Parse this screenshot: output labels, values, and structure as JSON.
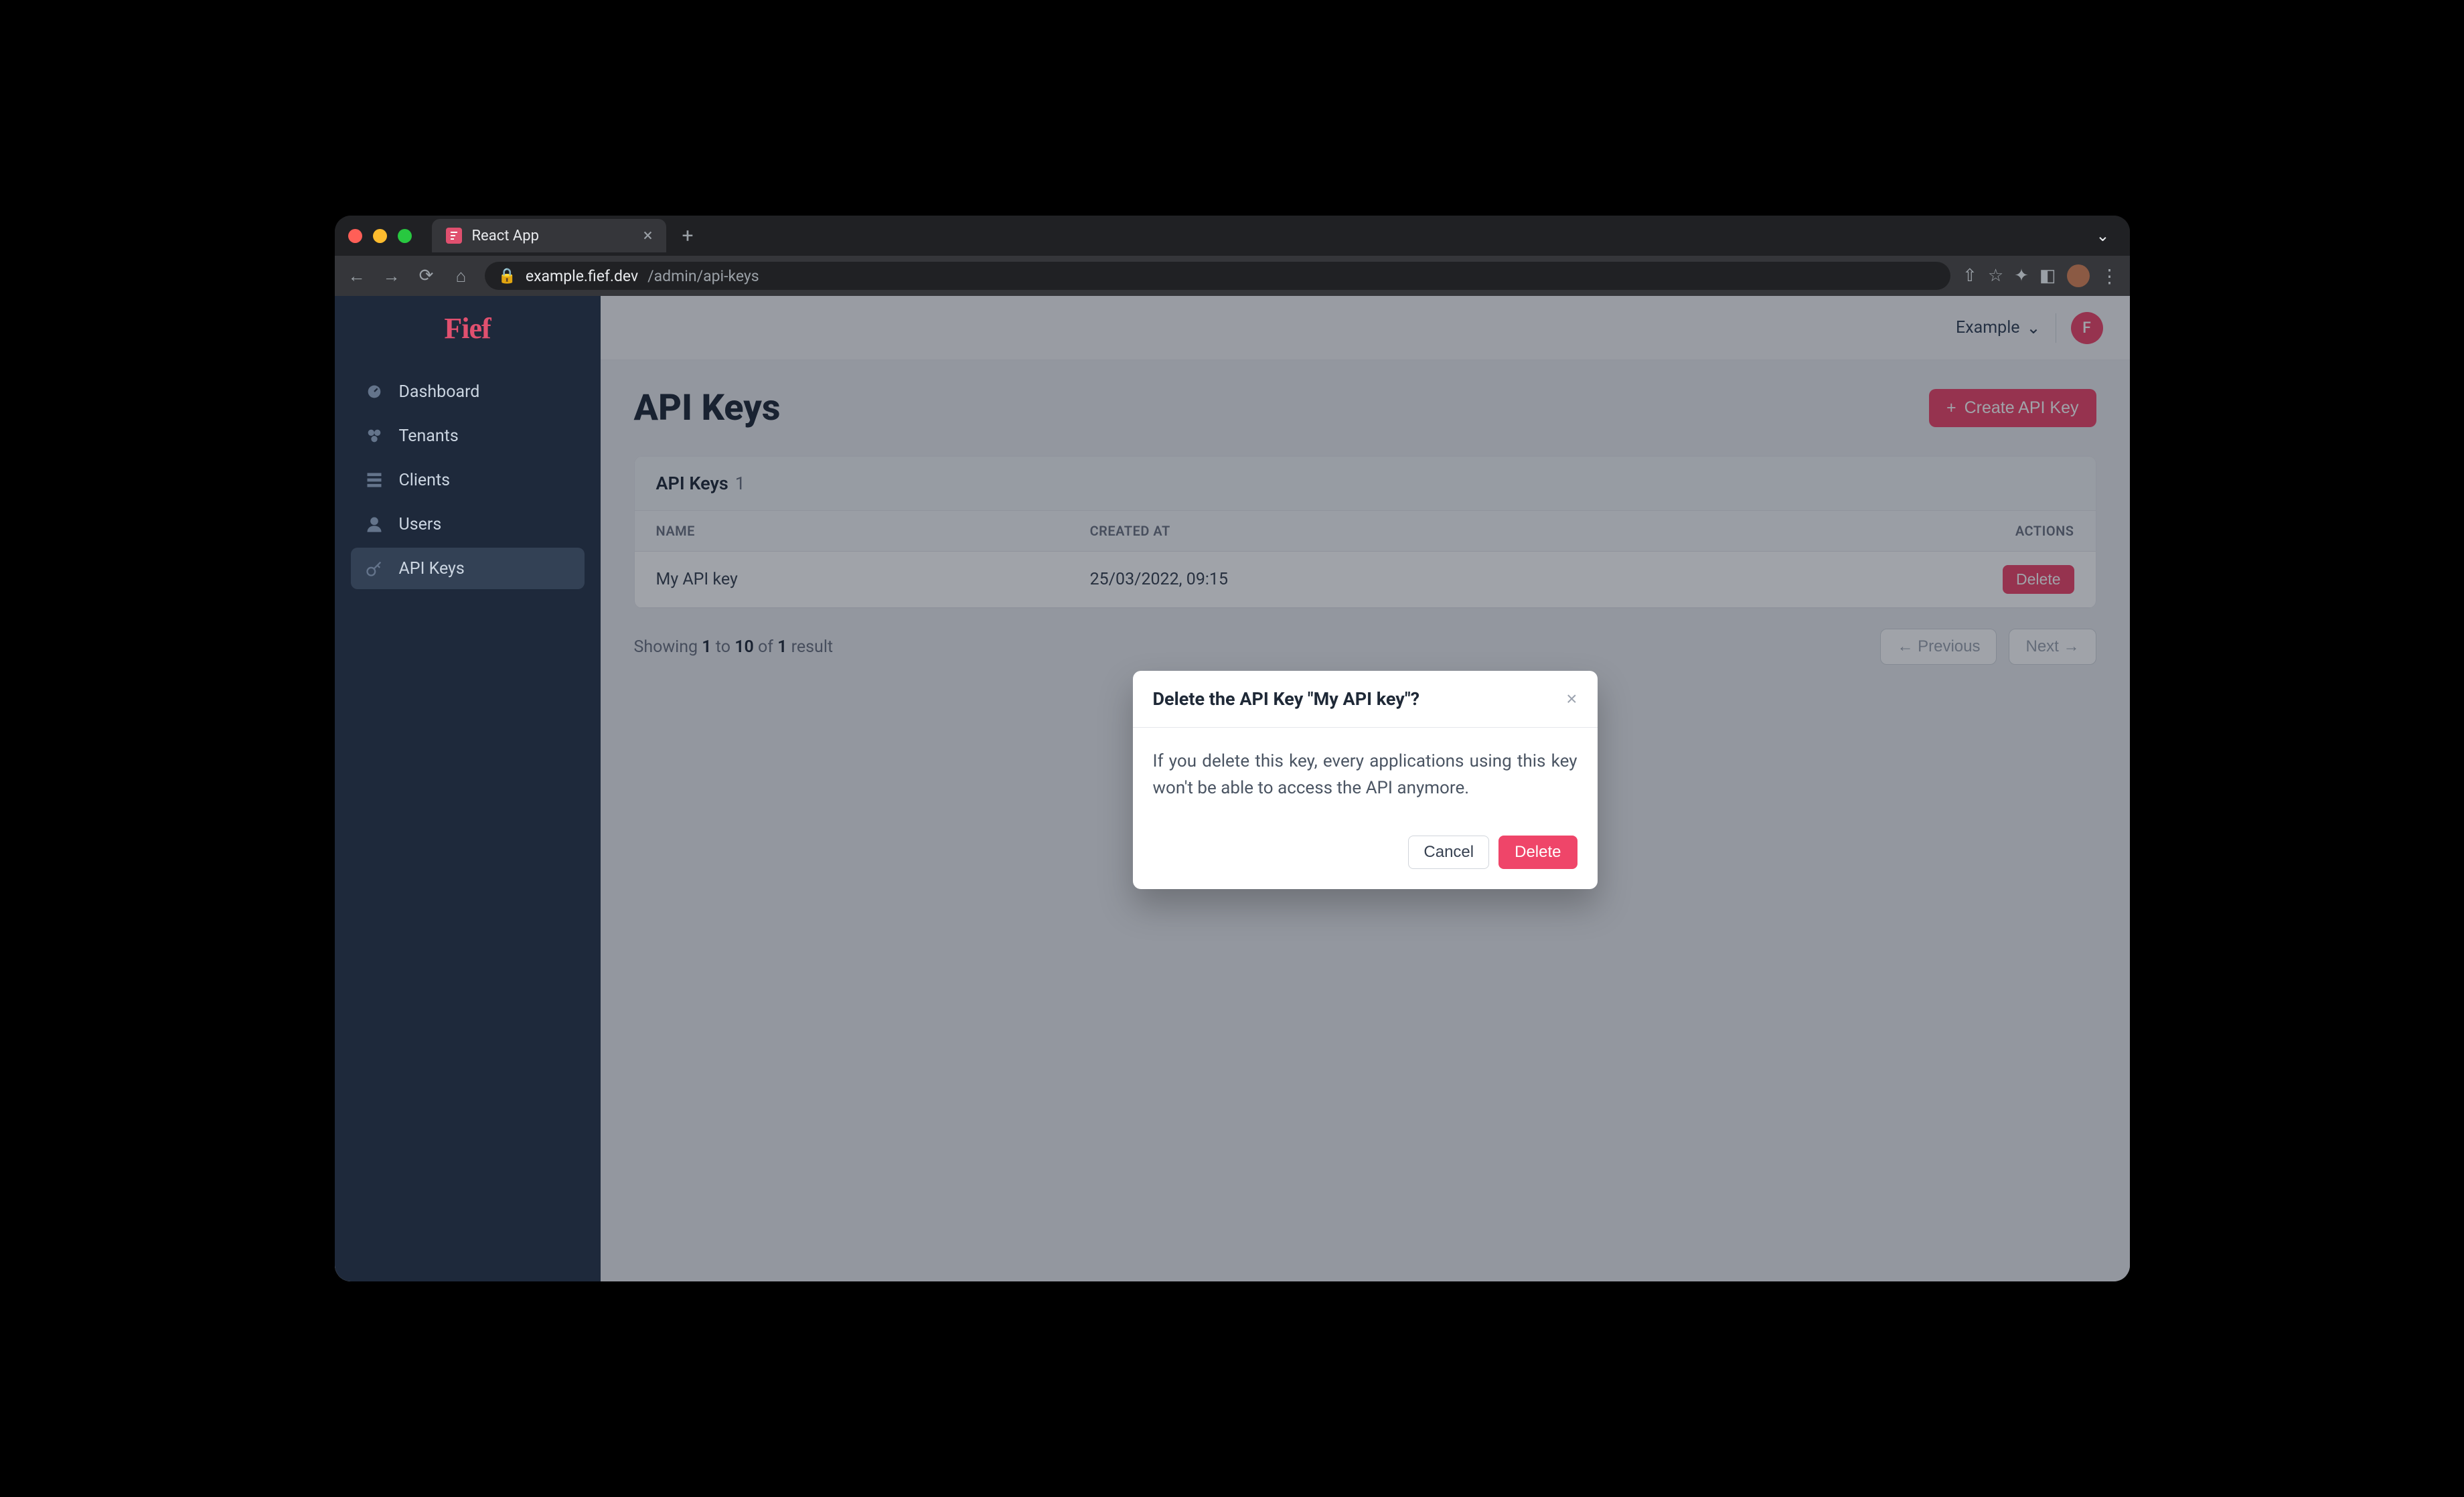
{
  "browser": {
    "tab_title": "React App",
    "url_host": "example.fief.dev",
    "url_path": "/admin/api-keys"
  },
  "brand": {
    "logo_text": "Fief"
  },
  "sidebar": {
    "items": [
      {
        "label": "Dashboard",
        "icon": "dashboard-icon",
        "active": false
      },
      {
        "label": "Tenants",
        "icon": "tenants-icon",
        "active": false
      },
      {
        "label": "Clients",
        "icon": "clients-icon",
        "active": false
      },
      {
        "label": "Users",
        "icon": "users-icon",
        "active": false
      },
      {
        "label": "API Keys",
        "icon": "key-icon",
        "active": true
      }
    ]
  },
  "topbar": {
    "workspace_label": "Example",
    "avatar_initial": "F"
  },
  "page": {
    "title": "API Keys",
    "create_button_label": "Create API Key"
  },
  "table": {
    "header_label": "API Keys",
    "count": "1",
    "columns": [
      "NAME",
      "CREATED AT",
      "ACTIONS"
    ],
    "rows": [
      {
        "name": "My API key",
        "created_at": "25/03/2022, 09:15",
        "delete_label": "Delete"
      }
    ]
  },
  "pagination": {
    "prefix": "Showing ",
    "from": "1",
    "to_word": " to ",
    "to": "10",
    "of_word": " of ",
    "total": "1",
    "result_word": " result",
    "previous_label": "← Previous",
    "next_label": "Next →"
  },
  "modal": {
    "title": "Delete the API Key \"My API key\"?",
    "body": "If you delete this key, every applications using this key won't be able to access the API anymore.",
    "cancel_label": "Cancel",
    "delete_label": "Delete"
  }
}
